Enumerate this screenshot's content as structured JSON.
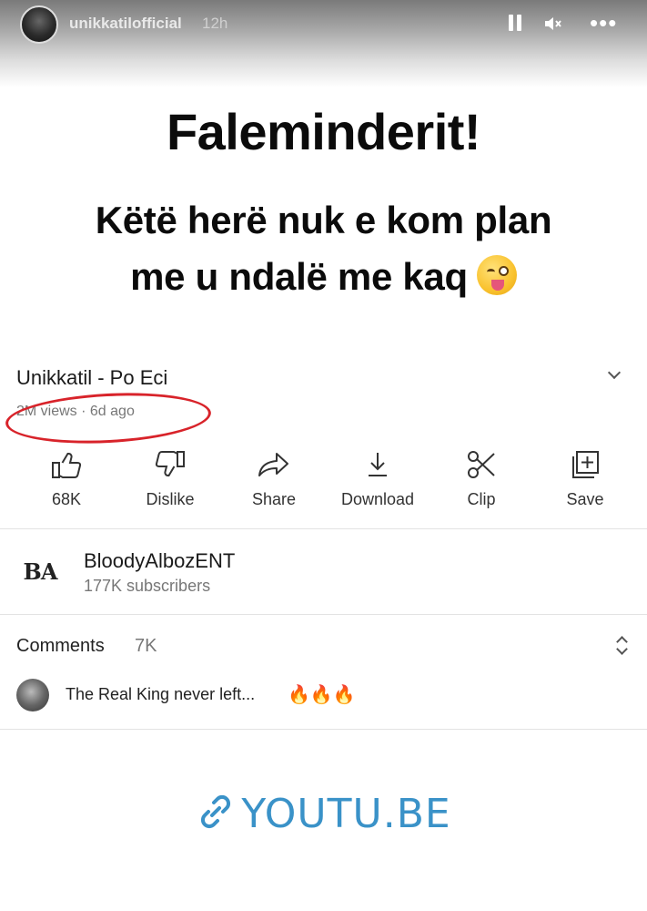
{
  "story": {
    "username": "unikkatilofficial",
    "time": "12h",
    "controls": [
      "pause-icon",
      "mute-icon",
      "more-icon"
    ],
    "more_glyph": "•••"
  },
  "headline": {
    "line1": "Faleminderit!",
    "line2": "Këtë herë nuk e kom plan",
    "line3": "me u ndalë me kaq",
    "emoji": "winking-face-with-tongue"
  },
  "video": {
    "title": "Unikkatil - Po Eci",
    "views": "2M views · 6d ago",
    "annotation_color": "#d8232a"
  },
  "actions": [
    {
      "label": "68K",
      "icon": "thumbs-up-icon"
    },
    {
      "label": "Dislike",
      "icon": "thumbs-down-icon"
    },
    {
      "label": "Share",
      "icon": "share-icon"
    },
    {
      "label": "Download",
      "icon": "download-icon"
    },
    {
      "label": "Clip",
      "icon": "scissors-icon"
    },
    {
      "label": "Save",
      "icon": "add-to-playlist-icon"
    }
  ],
  "channel": {
    "logo_text": "BA",
    "name": "BloodyAlbozENT",
    "subscribers": "177K subscribers"
  },
  "comments": {
    "label": "Comments",
    "count": "7K",
    "top_comment": "The Real King never left...",
    "top_comment_emojis": "🔥🔥🔥"
  },
  "link": {
    "text": "YOUTU.BE",
    "color": "#3a92c8"
  }
}
